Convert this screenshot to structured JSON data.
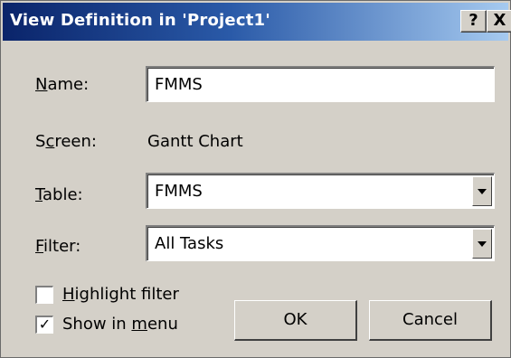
{
  "window": {
    "title": "View Definition in 'Project1'",
    "help_label": "?",
    "close_label": "X"
  },
  "name": {
    "label": "Name:",
    "value": "FMMS"
  },
  "screen": {
    "label": "Screen:",
    "value": "Gantt Chart"
  },
  "table": {
    "label": "Table:",
    "selected": "FMMS"
  },
  "filter": {
    "label": "Filter:",
    "selected": "All Tasks"
  },
  "options": {
    "highlight_filter": {
      "label": "Highlight filter",
      "checked": false
    },
    "show_in_menu": {
      "label": "Show in menu",
      "checked": true
    }
  },
  "buttons": {
    "ok": "OK",
    "cancel": "Cancel"
  },
  "colors": {
    "titlebar_start": "#0a246a",
    "titlebar_end": "#a6caf0",
    "dialog_face": "#d4d0c8"
  }
}
